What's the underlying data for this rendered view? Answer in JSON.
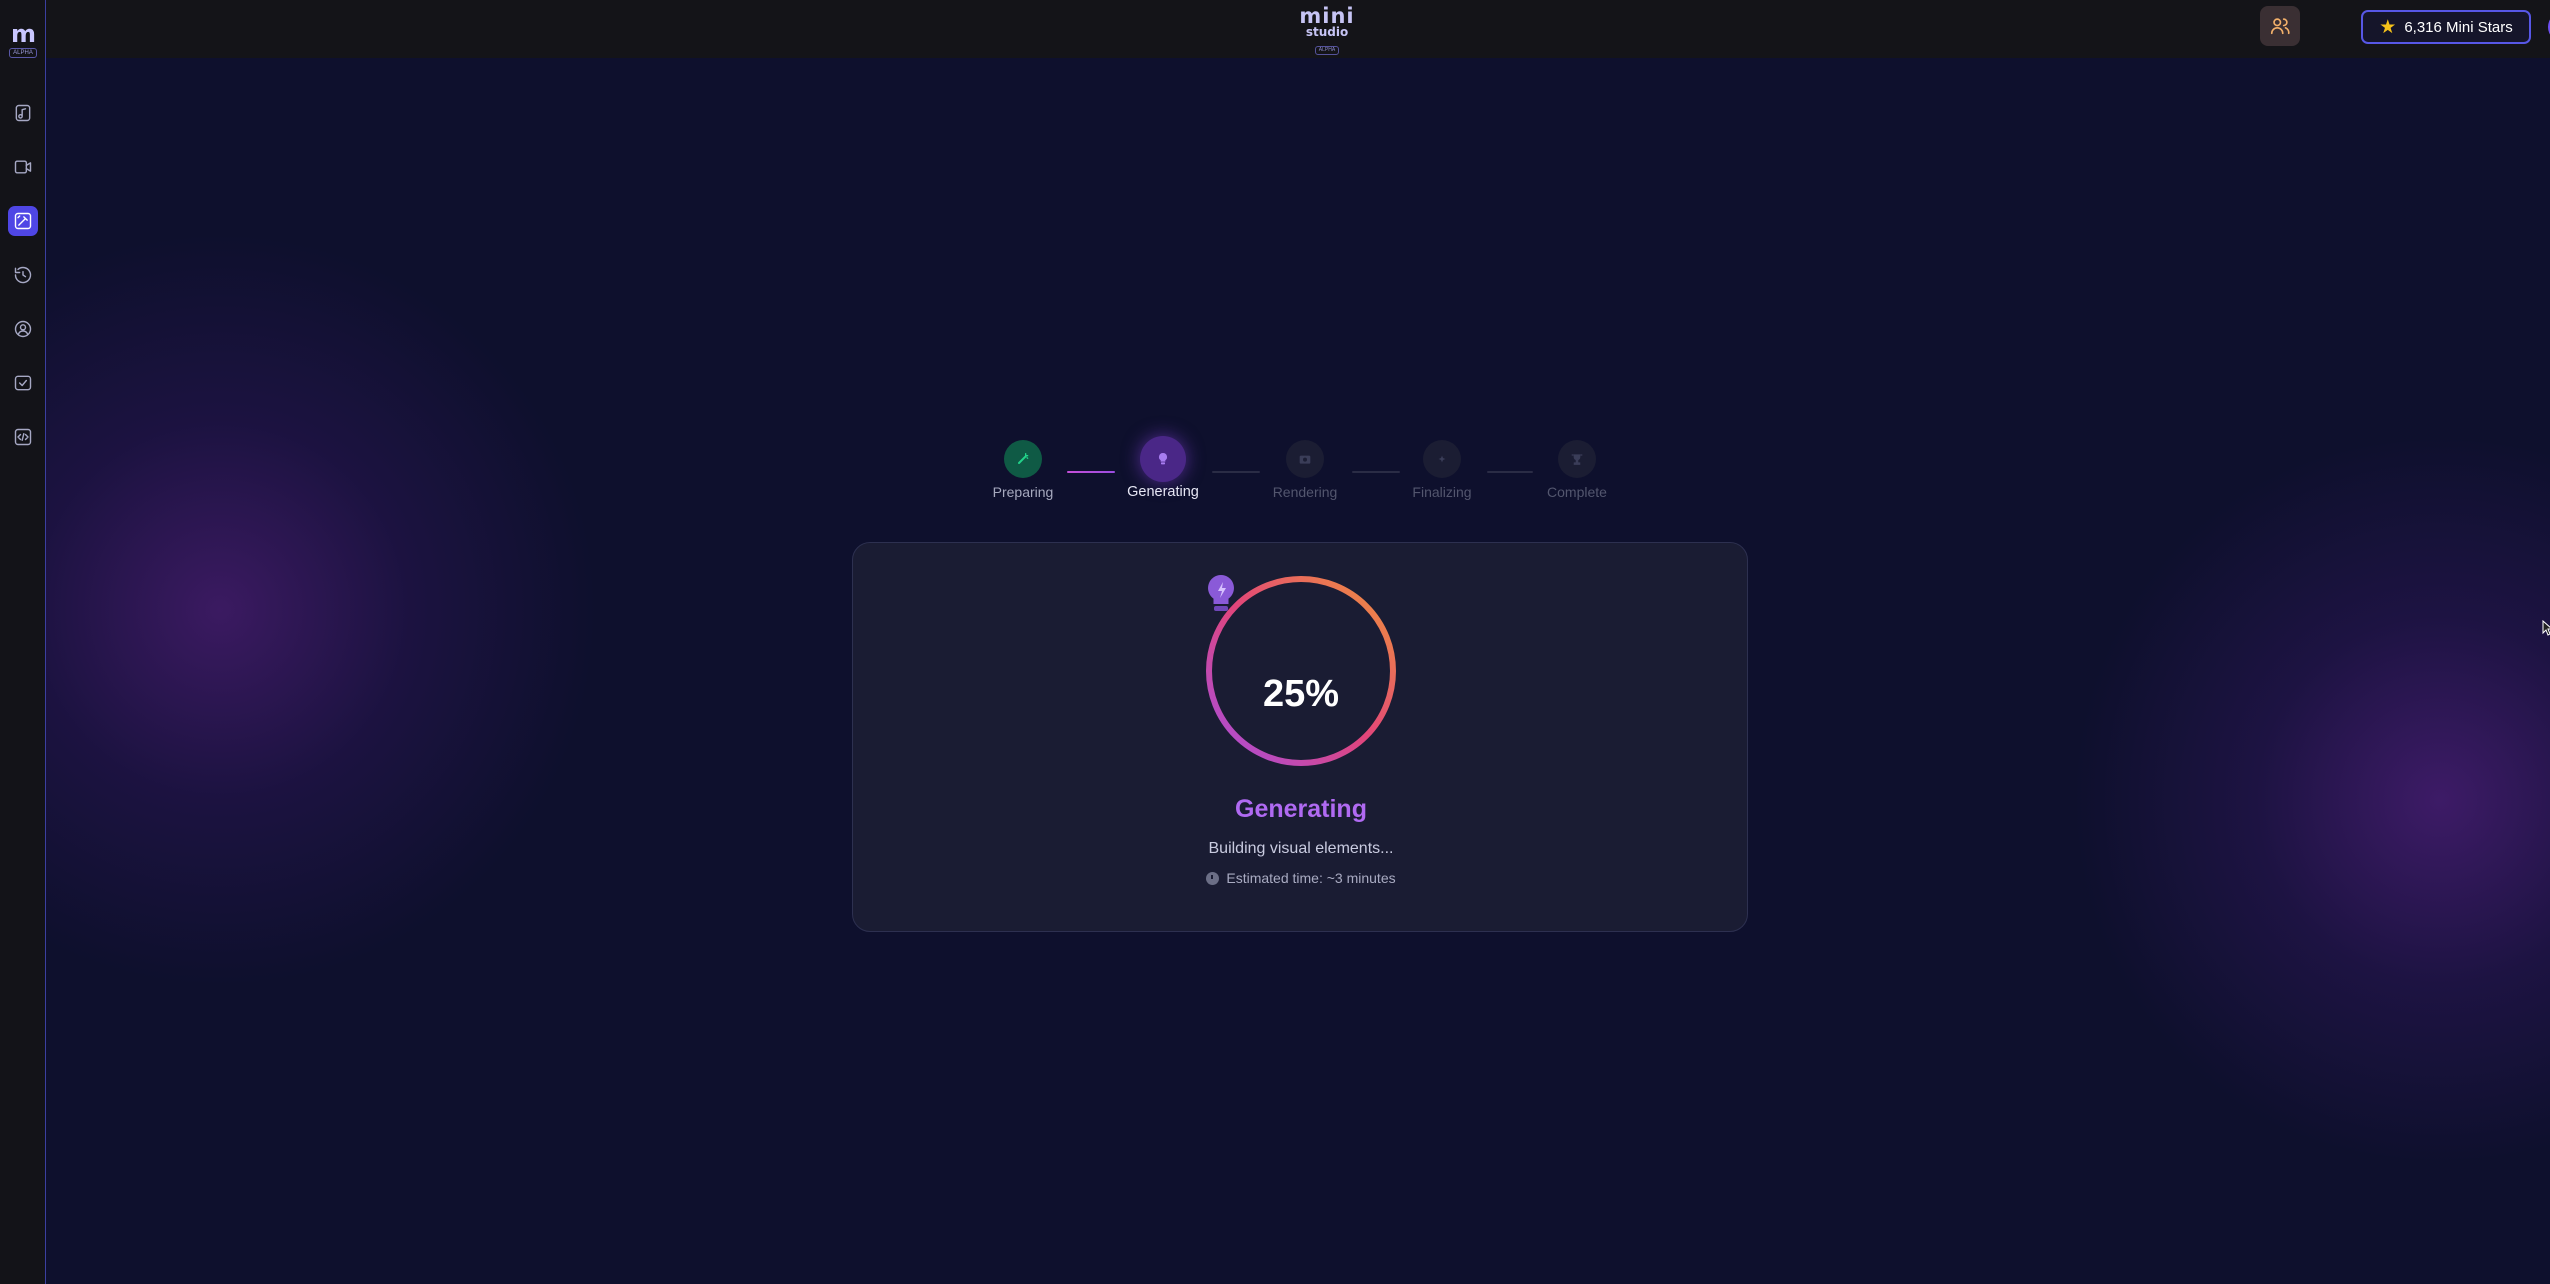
{
  "sidebar": {
    "logo_mark": "m",
    "logo_tag": "ALPHA",
    "items": [
      {
        "name": "music"
      },
      {
        "name": "video"
      },
      {
        "name": "create",
        "active": true
      },
      {
        "name": "history"
      },
      {
        "name": "profile"
      },
      {
        "name": "tasks"
      },
      {
        "name": "code"
      }
    ]
  },
  "header": {
    "brand_top": "mini",
    "brand_bottom": "studio",
    "brand_tag": "ALPHA",
    "stars_label": "6,316 Mini Stars",
    "team_icon": "users-icon",
    "avatar_icon": "user-icon"
  },
  "steps": [
    {
      "label": "Preparing",
      "state": "done"
    },
    {
      "label": "Generating",
      "state": "active"
    },
    {
      "label": "Rendering",
      "state": "pending"
    },
    {
      "label": "Finalizing",
      "state": "pending"
    },
    {
      "label": "Complete",
      "state": "pending"
    }
  ],
  "progress": {
    "percent_label": "25%",
    "percent_value": 0.25,
    "title": "Generating",
    "status": "Building visual elements...",
    "eta": "Estimated time: ~3 minutes"
  },
  "colors": {
    "accent": "#4f46e5",
    "ring_start": "#f0953a",
    "ring_mid": "#e2457a",
    "ring_end": "#a54ee0",
    "title": "#b06af2",
    "star": "#f6c21a"
  }
}
